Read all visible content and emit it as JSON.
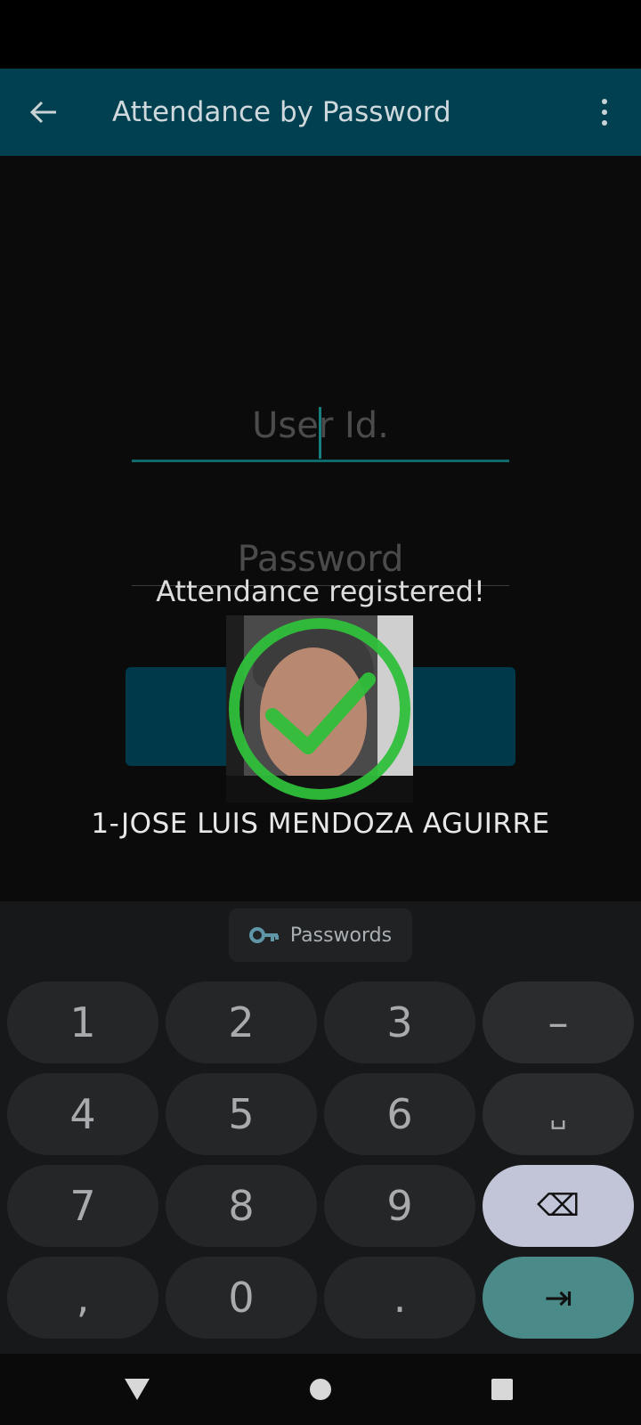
{
  "app_bar": {
    "title": "Attendance by Password"
  },
  "form": {
    "user_id_placeholder": "User Id.",
    "password_placeholder": "Password"
  },
  "overlay": {
    "message": "Attendance registered!",
    "person_name": "1-JOSE LUIS MENDOZA AGUIRRE"
  },
  "keyboard": {
    "chip_label": "Passwords",
    "keys": [
      "1",
      "2",
      "3",
      "–",
      "4",
      "5",
      "6",
      "␣",
      "7",
      "8",
      "9",
      "⌫",
      ",",
      "0",
      ".",
      "⇥"
    ]
  },
  "colors": {
    "app_bar": "#004050",
    "accent": "#0f6b6b",
    "check": "#2fbf3a",
    "enter_key": "#4a8a88",
    "delete_key": "#c2c5d8"
  }
}
